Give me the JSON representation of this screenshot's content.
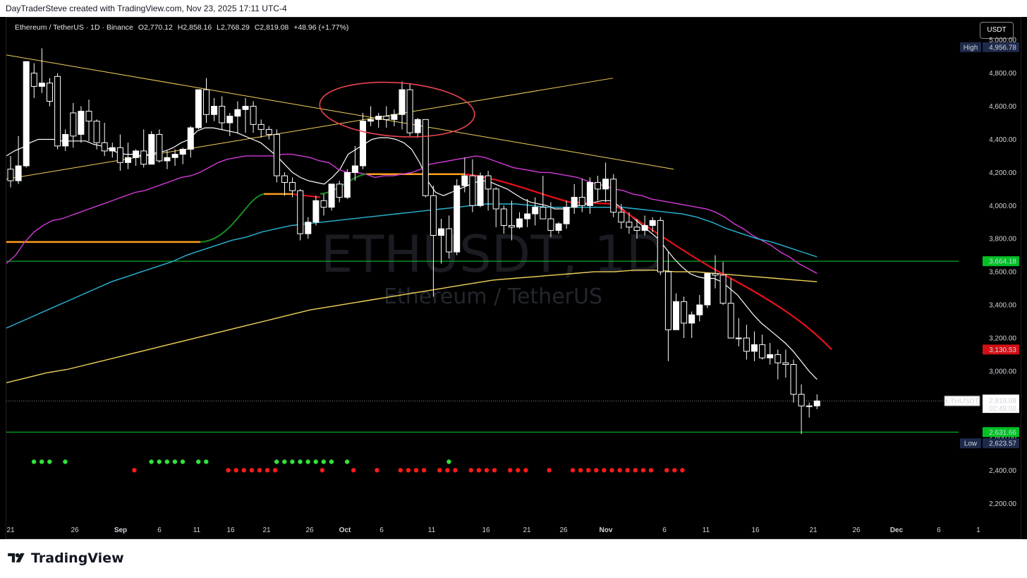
{
  "attribution": "DayTraderSteve created with TradingView.com, Nov 23, 2025 17:11 UTC-4",
  "brand": "TradingView",
  "header": {
    "symbol_line": "Ethereum / TetherUS · 1D · Binance",
    "open": "O2,770.12",
    "high": "H2,858.16",
    "low": "L2,768.29",
    "close": "C2,819.08",
    "change": "+48.96 (+1.77%)"
  },
  "currency_button": "USDT",
  "watermark": {
    "main": "ETHUSDT, 1D",
    "sub": "Ethereum / TetherUS"
  },
  "badges": {
    "high_label": "High",
    "high_value": "4,956.78",
    "resistance_value": "3,664.18",
    "ema_value": "3,130.53",
    "symbol_tag": "ETHUSDT",
    "last_price": "2,819.08",
    "countdown": "02:49:00",
    "support_value": "2,631.66",
    "low_label": "Low",
    "low_value": "2,623.57"
  },
  "colors": {
    "up": "#ffffff",
    "down": "#000000",
    "wick": "#ffffff",
    "trend": "#f2d35a",
    "ema_fast": "#ffffff",
    "ema_mid": "#d13ad6",
    "ema_slow": "#29b6d4",
    "ema_long": "#f2d35a",
    "red_line": "#e8101a",
    "green_line": "#00d52e",
    "level_orange": "#ff9f1a",
    "circle": "#e8434f"
  },
  "chart_data": {
    "type": "candlestick",
    "y_ticks": [
      "5,000.00",
      "4,800.00",
      "4,600.00",
      "4,400.00",
      "4,200.00",
      "4,000.00",
      "3,800.00",
      "3,600.00",
      "3,400.00",
      "3,200.00",
      "3,000.00",
      "2,800.00",
      "2,600.00",
      "2,400.00",
      "2,200.00"
    ],
    "x_ticks": [
      "21",
      "26",
      "Sep",
      "6",
      "11",
      "16",
      "21",
      "26",
      "Oct",
      "6",
      "11",
      "16",
      "21",
      "26",
      "Nov",
      "6",
      "11",
      "16",
      "21",
      "26",
      "Dec",
      "6",
      "1"
    ],
    "ylim": [
      2100,
      5050
    ],
    "candles": [
      [
        4220,
        4300,
        4110,
        4150
      ],
      [
        4150,
        4420,
        4130,
        4240
      ],
      [
        4240,
        4800,
        4230,
        4870
      ],
      [
        4800,
        4860,
        4650,
        4720
      ],
      [
        4720,
        4950,
        4680,
        4740
      ],
      [
        4740,
        4770,
        4600,
        4630
      ],
      [
        4780,
        4800,
        4340,
        4360
      ],
      [
        4360,
        4460,
        4330,
        4430
      ],
      [
        4560,
        4620,
        4350,
        4420
      ],
      [
        4430,
        4600,
        4380,
        4570
      ],
      [
        4570,
        4640,
        4390,
        4510
      ],
      [
        4510,
        4520,
        4340,
        4380
      ],
      [
        4380,
        4500,
        4300,
        4330
      ],
      [
        4330,
        4380,
        4290,
        4350
      ],
      [
        4350,
        4430,
        4210,
        4260
      ],
      [
        4260,
        4380,
        4220,
        4290
      ],
      [
        4290,
        4340,
        4240,
        4330
      ],
      [
        4330,
        4460,
        4230,
        4250
      ],
      [
        4250,
        4450,
        4250,
        4430
      ],
      [
        4430,
        4460,
        4260,
        4270
      ],
      [
        4270,
        4330,
        4220,
        4290
      ],
      [
        4290,
        4340,
        4240,
        4310
      ],
      [
        4310,
        4350,
        4250,
        4340
      ],
      [
        4340,
        4480,
        4290,
        4470
      ],
      [
        4470,
        4700,
        4460,
        4700
      ],
      [
        4700,
        4770,
        4500,
        4550
      ],
      [
        4550,
        4650,
        4510,
        4600
      ],
      [
        4600,
        4660,
        4460,
        4500
      ],
      [
        4500,
        4560,
        4420,
        4540
      ],
      [
        4540,
        4630,
        4440,
        4580
      ],
      [
        4580,
        4650,
        4440,
        4600
      ],
      [
        4600,
        4630,
        4440,
        4490
      ],
      [
        4490,
        4520,
        4410,
        4460
      ],
      [
        4460,
        4480,
        4400,
        4430
      ],
      [
        4430,
        4460,
        4140,
        4180
      ],
      [
        4180,
        4200,
        4060,
        4140
      ],
      [
        4140,
        4170,
        4050,
        4090
      ],
      [
        4090,
        4100,
        3790,
        3830
      ],
      [
        3830,
        3930,
        3800,
        3900
      ],
      [
        3900,
        4060,
        3880,
        4030
      ],
      [
        4030,
        4070,
        3940,
        3990
      ],
      [
        3990,
        4120,
        3970,
        4130
      ],
      [
        4130,
        4150,
        4020,
        4050
      ],
      [
        4050,
        4220,
        4040,
        4200
      ],
      [
        4200,
        4360,
        4150,
        4240
      ],
      [
        4240,
        4560,
        4220,
        4510
      ],
      [
        4510,
        4600,
        4480,
        4520
      ],
      [
        4520,
        4560,
        4470,
        4540
      ],
      [
        4540,
        4600,
        4470,
        4520
      ],
      [
        4520,
        4580,
        4480,
        4550
      ],
      [
        4550,
        4750,
        4460,
        4700
      ],
      [
        4700,
        4740,
        4420,
        4440
      ],
      [
        4440,
        4530,
        4410,
        4520
      ],
      [
        4520,
        4480,
        4050,
        4060
      ],
      [
        4060,
        4120,
        3450,
        3820
      ],
      [
        3820,
        3920,
        3650,
        3860
      ],
      [
        3860,
        3940,
        3680,
        3720
      ],
      [
        3720,
        4160,
        3700,
        4120
      ],
      [
        4120,
        4290,
        4080,
        4180
      ],
      [
        4180,
        4280,
        3960,
        4000
      ],
      [
        4000,
        4200,
        3990,
        4180
      ],
      [
        4180,
        4210,
        3970,
        4100
      ],
      [
        4100,
        4110,
        3870,
        3980
      ],
      [
        3980,
        4000,
        3830,
        3880
      ],
      [
        3880,
        4030,
        3790,
        3870
      ],
      [
        3870,
        3960,
        3860,
        3920
      ],
      [
        3920,
        4040,
        3870,
        3950
      ],
      [
        3950,
        4050,
        3880,
        3990
      ],
      [
        3990,
        4180,
        3950,
        3920
      ],
      [
        3920,
        4020,
        3810,
        3850
      ],
      [
        3850,
        3900,
        3830,
        3890
      ],
      [
        3890,
        4030,
        3860,
        3990
      ],
      [
        3990,
        4130,
        3950,
        4050
      ],
      [
        4050,
        4160,
        3960,
        4000
      ],
      [
        4000,
        4170,
        3950,
        4140
      ],
      [
        4140,
        4180,
        4030,
        4100
      ],
      [
        4100,
        4260,
        4020,
        4160
      ],
      [
        4160,
        4190,
        3930,
        3960
      ],
      [
        3960,
        4010,
        3860,
        3900
      ],
      [
        3900,
        3960,
        3830,
        3870
      ],
      [
        3870,
        3920,
        3800,
        3850
      ],
      [
        3850,
        3940,
        3820,
        3880
      ],
      [
        3880,
        3930,
        3840,
        3910
      ],
      [
        3910,
        3930,
        3580,
        3600
      ],
      [
        3600,
        3720,
        3060,
        3250
      ],
      [
        3250,
        3470,
        3250,
        3420
      ],
      [
        3420,
        3450,
        3200,
        3290
      ],
      [
        3290,
        3360,
        3200,
        3340
      ],
      [
        3340,
        3460,
        3300,
        3400
      ],
      [
        3400,
        3570,
        3380,
        3590
      ],
      [
        3590,
        3700,
        3500,
        3580
      ],
      [
        3580,
        3660,
        3400,
        3410
      ],
      [
        3410,
        3560,
        3380,
        3200
      ],
      [
        3200,
        3320,
        3150,
        3200
      ],
      [
        3200,
        3280,
        3070,
        3120
      ],
      [
        3120,
        3240,
        3060,
        3160
      ],
      [
        3160,
        3220,
        3070,
        3080
      ],
      [
        3080,
        3170,
        3040,
        3100
      ],
      [
        3100,
        3130,
        2950,
        3050
      ],
      [
        3050,
        3130,
        2960,
        3040
      ],
      [
        3040,
        3070,
        2810,
        2860
      ],
      [
        2860,
        2920,
        2620,
        2790
      ],
      [
        2790,
        2810,
        2720,
        2790
      ],
      [
        2790,
        2860,
        2770,
        2820
      ]
    ],
    "series": [
      {
        "values": [
          4300,
          4330,
          4350,
          4380,
          4400,
          4400,
          4400,
          4390,
          4390,
          4390,
          4390,
          4370,
          4360,
          4340,
          4320,
          4310,
          4310,
          4300,
          4310,
          4320,
          4330,
          4350,
          4380,
          4400,
          4450,
          4470,
          4470,
          4460,
          4450,
          4440,
          4420,
          4400,
          4380,
          4340,
          4300,
          4250,
          4200,
          4170,
          4150,
          4140,
          4130,
          4170,
          4220,
          4310,
          4340,
          4370,
          4400,
          4410,
          4410,
          4400,
          4380,
          4340,
          4260,
          4150,
          4080,
          4060,
          4080,
          4100,
          4120,
          4140,
          4150,
          4140,
          4120,
          4100,
          4070,
          4040,
          4020,
          4010,
          4000,
          3980,
          3980,
          3990,
          4000,
          4010,
          4020,
          4030,
          4030,
          4000,
          3960,
          3920,
          3880,
          3840,
          3800,
          3740,
          3680,
          3630,
          3590,
          3570,
          3560,
          3560,
          3540,
          3500,
          3460,
          3400,
          3340,
          3290,
          3250,
          3210,
          3170,
          3120,
          3060,
          3000,
          2950
        ]
      },
      {
        "values": [
          3650,
          3700,
          3780,
          3840,
          3880,
          3910,
          3920,
          3940,
          3960,
          3980,
          4000,
          4020,
          4040,
          4060,
          4080,
          4090,
          4110,
          4130,
          4150,
          4170,
          4180,
          4200,
          4230,
          4260,
          4280,
          4290,
          4300,
          4300,
          4300,
          4300,
          4310,
          4310,
          4300,
          4290,
          4270,
          4260,
          4220,
          4200,
          4200,
          4190,
          4170,
          4180,
          4180,
          4190,
          4200,
          4220,
          4250,
          4260,
          4270,
          4280,
          4290,
          4300,
          4290,
          4270,
          4250,
          4230,
          4220,
          4210,
          4200,
          4200,
          4190,
          4180,
          4170,
          4150,
          4130,
          4120,
          4100,
          4090,
          4070,
          4060,
          4040,
          4030,
          4020,
          4010,
          4000,
          3990,
          3980,
          3960,
          3930,
          3890,
          3860,
          3820,
          3790,
          3760,
          3720,
          3690,
          3650,
          3620,
          3590
        ]
      },
      {
        "values": [
          3260,
          3300,
          3340,
          3380,
          3420,
          3460,
          3500,
          3540,
          3570,
          3600,
          3630,
          3660,
          3700,
          3730,
          3760,
          3790,
          3810,
          3840,
          3860,
          3880,
          3890,
          3900,
          3910,
          3920,
          3930,
          3940,
          3950,
          3960,
          3970,
          3980,
          3990,
          4000,
          4010,
          4010,
          4010,
          4000,
          3990,
          3990,
          3990,
          3990,
          3990,
          3990,
          3980,
          3970,
          3960,
          3950,
          3930,
          3900,
          3860,
          3830,
          3800,
          3780,
          3750,
          3720,
          3690
        ]
      },
      {
        "values": [
          2930,
          2960,
          2990,
          3010,
          3040,
          3070,
          3100,
          3130,
          3160,
          3190,
          3220,
          3250,
          3280,
          3310,
          3340,
          3370,
          3390,
          3410,
          3430,
          3450,
          3470,
          3490,
          3510,
          3530,
          3550,
          3560,
          3570,
          3580,
          3590,
          3600,
          3600,
          3610,
          3610,
          3600,
          3600,
          3590,
          3580,
          3570,
          3560,
          3550,
          3540
        ]
      }
    ],
    "levels": [
      3664.18,
      2631.66
    ],
    "markers": {
      "green": [
        1,
        2,
        3,
        5,
        16,
        17,
        18,
        19,
        20,
        22,
        23,
        32,
        33,
        34,
        35,
        36,
        37,
        38,
        39,
        41,
        54
      ],
      "red": [
        14,
        26,
        27,
        28,
        29,
        30,
        31,
        32,
        38,
        42,
        45,
        48,
        49,
        50,
        51,
        53,
        54,
        55,
        57,
        58,
        59,
        60,
        62,
        63,
        64,
        67,
        70,
        71,
        72,
        73,
        74,
        75,
        76,
        77,
        78,
        79,
        80,
        82,
        83,
        84
      ]
    }
  }
}
